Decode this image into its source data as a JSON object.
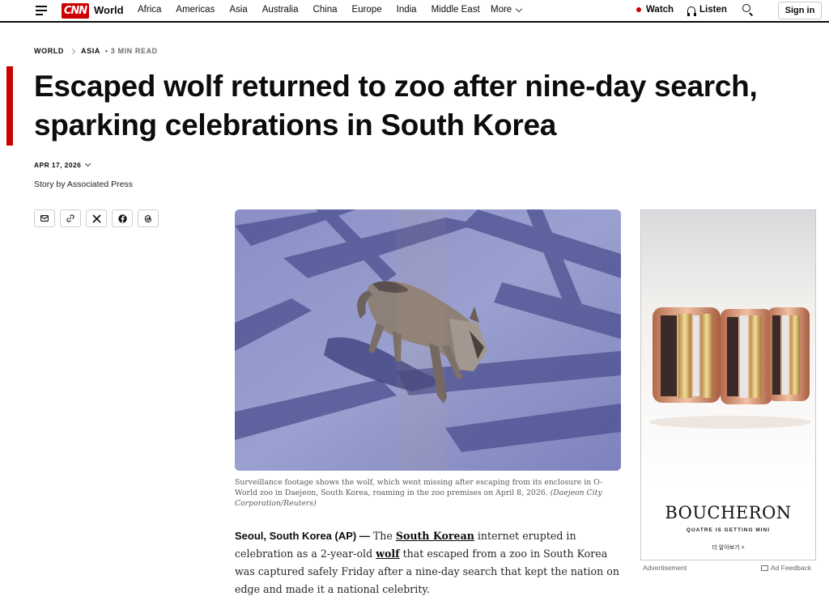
{
  "nav": {
    "brand": "CNN",
    "section": "World",
    "links": [
      "Africa",
      "Americas",
      "Asia",
      "Australia",
      "China",
      "Europe",
      "India",
      "Middle East"
    ],
    "more_label": "More",
    "watch_label": "Watch",
    "listen_label": "Listen",
    "signin_label": "Sign in"
  },
  "article": {
    "breadcrumb": [
      "WORLD",
      "ASIA"
    ],
    "read_time": "3 MIN READ",
    "headline": "Escaped wolf returned to zoo after nine-day search, sparking celebrations in South Korea",
    "date": "APR 17, 2026",
    "byline": "Story by Associated Press",
    "caption_text": "Surveillance footage shows the wolf, which went missing after escaping from its enclosure in O-World zoo in Daejeon, South Korea, roaming in the zoo premises on April 8, 2026.",
    "caption_credit": "(Daejeon City Corporation/Reuters)",
    "body": {
      "dateline": "Seoul, South Korea (AP) —",
      "t1": "The",
      "link1": "South Korean",
      "t2": "internet erupted in celebration as a 2-year-old",
      "link2": "wolf",
      "t3": "that escaped from a zoo in South Korea was captured safely Friday after a nine-day search that kept the nation on edge and made it a national celebrity."
    }
  },
  "share_icons": [
    "email-icon",
    "link-icon",
    "x-icon",
    "facebook-icon",
    "threads-icon"
  ],
  "ad": {
    "brand": "BOUCHERON",
    "tagline": "QUATRE IS GETTING MINI",
    "cta": "더 알아보기 >",
    "label": "Advertisement",
    "feedback": "Ad Feedback"
  },
  "colors": {
    "accent": "#cc0000",
    "text": "#0c0c0c"
  }
}
